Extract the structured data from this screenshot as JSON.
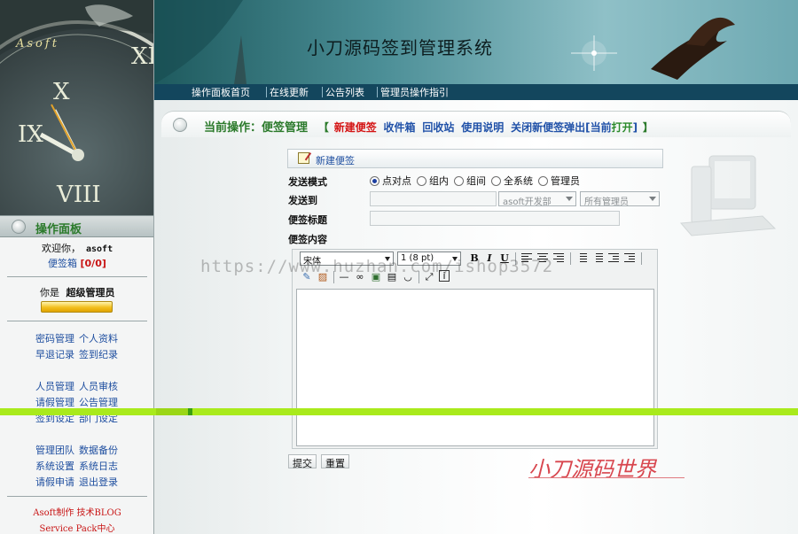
{
  "app": {
    "title": "小刀源码签到管理系统",
    "brand": "Asoft"
  },
  "nav": {
    "items": [
      "操作面板首页",
      "在线更新",
      "公告列表",
      "管理员操作指引"
    ]
  },
  "sidebar": {
    "panel_title": "操作面板",
    "welcome_label": "欢迎你，",
    "username": "asoft",
    "inbox_label": "便签箱",
    "inbox_count": "[0/0]",
    "role_prefix": "你是",
    "role": "超级管理员",
    "menu_rows": [
      [
        "密码管理",
        "个人资料"
      ],
      [
        "早退记录",
        "签到纪录"
      ],
      [
        "人员管理",
        "人员审核"
      ],
      [
        "请假管理",
        "公告管理"
      ],
      [
        "签到设定",
        "部门设定"
      ],
      [
        "管理团队",
        "数据备份"
      ],
      [
        "系统设置",
        "系统日志"
      ],
      [
        "请假申请",
        "退出登录"
      ]
    ],
    "footer_line1": "Asoft制作 技术BLOG",
    "footer_line2": "Service Pack中心"
  },
  "breadcrumb": {
    "prefix": "当前操作：便签管理",
    "open_bracket": "【",
    "close_bracket": "】",
    "links": [
      {
        "label": "新建便签",
        "state": "active"
      },
      {
        "label": "收件箱",
        "state": "normal"
      },
      {
        "label": "回收站",
        "state": "normal"
      },
      {
        "label": "使用说明",
        "state": "normal"
      },
      {
        "label": "关闭新便签弹出",
        "state": "normal"
      }
    ],
    "current_prefix": "[当前",
    "current_value": "打开",
    "current_suffix": "]"
  },
  "form": {
    "header": "新建便签",
    "send_mode_label": "发送模式",
    "send_modes": [
      {
        "label": "点对点",
        "selected": true
      },
      {
        "label": "组内",
        "selected": false
      },
      {
        "label": "组间",
        "selected": false
      },
      {
        "label": "全系统",
        "selected": false
      },
      {
        "label": "管理员",
        "selected": false
      }
    ],
    "send_to_label": "发送到",
    "dept_select": "asoft开发部",
    "admin_select": "所有管理员",
    "subject_label": "便签标题",
    "subject_value": "",
    "content_label": "便签内容",
    "submit_label": "提交",
    "reset_label": "重置"
  },
  "editor": {
    "font_value": "宋体",
    "size_value": "1 (8 pt)",
    "bold": "B",
    "italic": "I",
    "underline": "U",
    "body": ""
  },
  "overlay": {
    "watermark": "https://www.huzhan.com/ishop3572",
    "signature": "小刀源码世界"
  },
  "colors": {
    "accent_green": "#2b7a2b",
    "link_blue": "#2051a8",
    "alert_red": "#d41414",
    "nav_bar": "#13465d"
  }
}
